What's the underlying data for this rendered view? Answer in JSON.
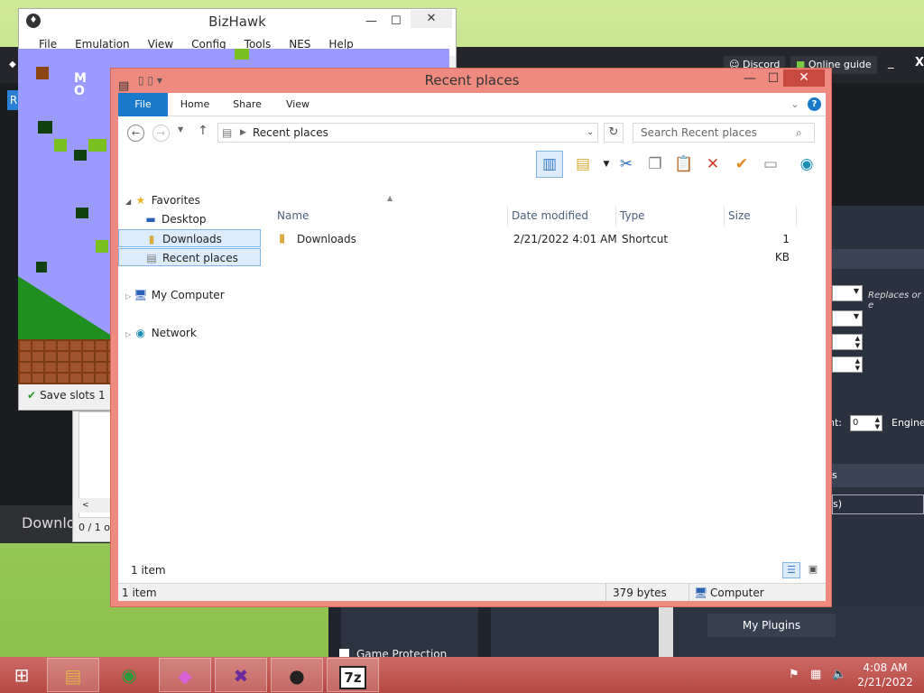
{
  "darkapp": {
    "discord_label": "Discord",
    "online_guide_label": "Online guide",
    "min_label": "_",
    "close_label": "X",
    "replaces_label": "Replaces or e",
    "count_label": "nt:",
    "count_value": "0",
    "engine_label": "Engine",
    "s_label": "s",
    "paren_label": "s)",
    "my_plugins_label": "My Plugins",
    "game_protection_label": "Game Protection",
    "downlo_label": "Downlo"
  },
  "sidedlg": {
    "pager_text": "0 / 1 o"
  },
  "bizhawk": {
    "title": "BizHawk",
    "menu": [
      "File",
      "Emulation",
      "View",
      "Config",
      "Tools",
      "NES",
      "Help"
    ],
    "status_label": "Save slots",
    "status_value": "1"
  },
  "explorer": {
    "title": "Recent places",
    "ribbon_tabs": [
      "File",
      "Home",
      "Share",
      "View"
    ],
    "address": "Recent places",
    "search_placeholder": "Search Recent places",
    "nav": {
      "favorites": "Favorites",
      "desktop": "Desktop",
      "downloads": "Downloads",
      "recent_places": "Recent places",
      "my_computer": "My Computer",
      "network": "Network"
    },
    "columns": [
      "Name",
      "Date modified",
      "Type",
      "Size"
    ],
    "files": [
      {
        "name": "Downloads",
        "date": "2/21/2022 4:01 AM",
        "type": "Shortcut",
        "size": "1 KB"
      }
    ],
    "item_count": "1 item",
    "status_items": "1 item",
    "status_bytes": "379 bytes",
    "status_location": "Computer"
  },
  "taskbar": {
    "time": "4:08 AM",
    "date": "2/21/2022",
    "apps": [
      "start-icon",
      "file-explorer-icon",
      "chrome-icon",
      "gem-app-icon",
      "purple-cat-app-icon",
      "hitman-app-icon",
      "7zip-icon"
    ],
    "seven_zip_label": "7z"
  }
}
